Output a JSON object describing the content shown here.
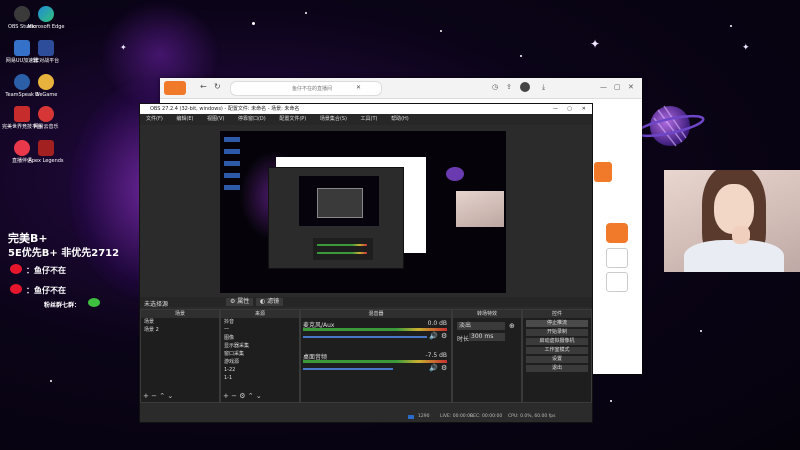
{
  "desktop_icons": [
    {
      "label": "OBS Studio",
      "color": "#3a3a3a"
    },
    {
      "label": "Microsoft Edge",
      "color": "#1f8ad6"
    },
    {
      "label": "网易UU加速器",
      "color": "#3570c9"
    },
    {
      "label": "5E对战平台",
      "color": "#2d4d9a"
    },
    {
      "label": "TeamSpeak 3",
      "color": "#2b5fa8"
    },
    {
      "label": "WeGame",
      "color": "#e8b33c"
    },
    {
      "label": "完美世界竞技平台",
      "color": "#c62c2c"
    },
    {
      "label": "网易云音乐",
      "color": "#d63636"
    },
    {
      "label": "直播伴侣",
      "color": "#e8384a"
    },
    {
      "label": "Apex Legends",
      "color": "#a32020"
    }
  ],
  "overlay": {
    "rank_line1": "完美B+",
    "rank_line2": "5E优先B+  非优先2712",
    "weibo_label": "：鱼仔不在",
    "weibo2_label": "：鱼仔不在",
    "group_text": "粉丝群七群：",
    "weibo_icon": "weibo-icon",
    "wechat_icon": "wechat-icon"
  },
  "browser": {
    "address_text": "鱼仔不在的直播间",
    "tab_icon": "close-icon"
  },
  "obs": {
    "title": "OBS 27.2.4 (32-bit, windows) - 配置文件: 未命名 - 场景: 未命名",
    "menu": [
      "文件(F)",
      "编辑(E)",
      "视图(V)",
      "停靠窗口(D)",
      "配置文件(P)",
      "场景集合(S)",
      "工具(T)",
      "帮助(H)"
    ],
    "source_toolbar": {
      "selected": "未选择源",
      "properties": "属性",
      "filters": "滤镜"
    },
    "scenes_header": "场景",
    "scenes": [
      "场景",
      "场景 2"
    ],
    "sources_header": "来源",
    "sources": [
      "抖音",
      "一",
      "图像",
      "显示器采集",
      "窗口采集",
      "游戏源",
      "1-22",
      "1-1"
    ],
    "mixer_header": "混音器",
    "mixer": [
      {
        "name": "麦克风/Aux",
        "level": "0.0 dB"
      },
      {
        "name": "桌面音频",
        "level": "-7.5 dB"
      }
    ],
    "transition_header": "转场特效",
    "transition": {
      "type": "淡出",
      "duration_label": "时长",
      "duration": "300 ms"
    },
    "controls_header": "控件",
    "controls": [
      "停止推流",
      "开始录制",
      "启动虚拟摄像机",
      "工作室模式",
      "设置",
      "退出"
    ],
    "status": {
      "live": "LIVE: 00:00:00",
      "rec": "REC: 00:00:00",
      "cpu": "CPU: 0.0%, 60.00 fps",
      "frames": "1290"
    }
  }
}
